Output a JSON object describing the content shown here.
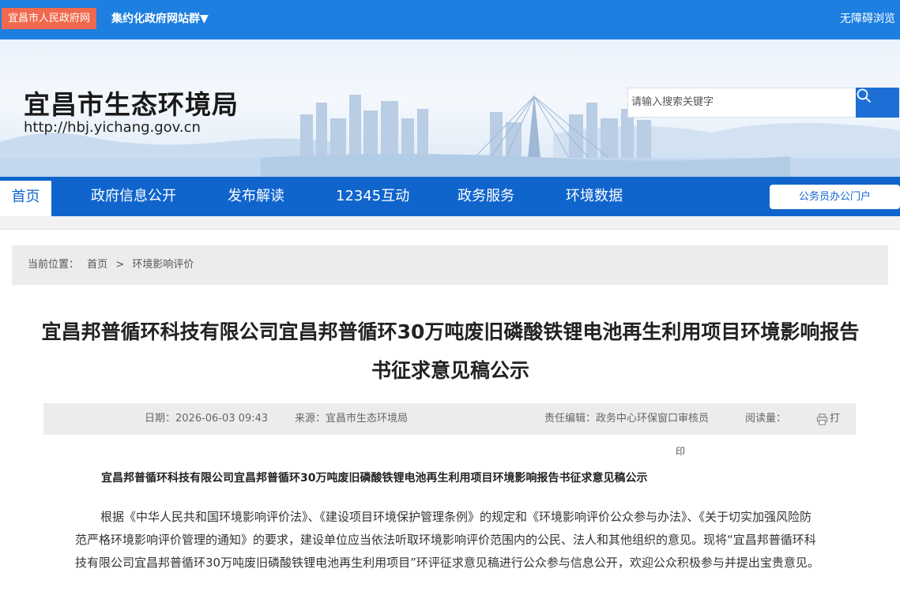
{
  "topbar": {
    "site_tag": "宜昌市人民政府网",
    "group_link": "集约化政府网站群▼",
    "accessibility": "无障碍浏览"
  },
  "header": {
    "title": "宜昌市生态环境局",
    "url": "http://hbj.yichang.gov.cn",
    "search_placeholder": "请输入搜索关键字"
  },
  "nav": {
    "items": [
      "首页",
      "政府信息公开",
      "发布解读",
      "12345互动",
      "政务服务",
      "环境数据"
    ],
    "portal": "公务员办公门户"
  },
  "breadcrumb": {
    "label": "当前位置：",
    "home": "首页",
    "sep": ">",
    "current": "环境影响评价"
  },
  "article": {
    "title": "宜昌邦普循环科技有限公司宜昌邦普循环30万吨废旧磷酸铁锂电池再生利用项目环境影响报告书征求意见稿公示",
    "meta": {
      "date": "日期：2026-06-03 09:43",
      "source": "来源：宜昌市生态环境局",
      "editor": "责任编辑：政务中心环保窗口审核员",
      "views": "阅读量：",
      "print_a": "打",
      "print_b": "印"
    },
    "subtitle": "宜昌邦普循环科技有限公司宜昌邦普循环30万吨废旧磷酸铁锂电池再生利用项目环境影响报告书征求意见稿公示",
    "paragraph": "根据《中华人民共和国环境影响评价法》、《建设项目环境保护管理条例》的规定和《环境影响评价公众参与办法》、《关于切实加强风险防范严格环境影响评价管理的通知》的要求，建设单位应当依法听取环境影响评价范围内的公民、法人和其他组织的意见。现将“宜昌邦普循环科技有限公司宜昌邦普循环30万吨废旧磷酸铁锂电池再生利用项目”环评征求意见稿进行公众参与信息公开，欢迎公众积极参与并提出宝贵意见。"
  },
  "colors": {
    "topbar": "#1d7fe0",
    "nav": "#1065cd",
    "site_tag": "#f0694e"
  }
}
